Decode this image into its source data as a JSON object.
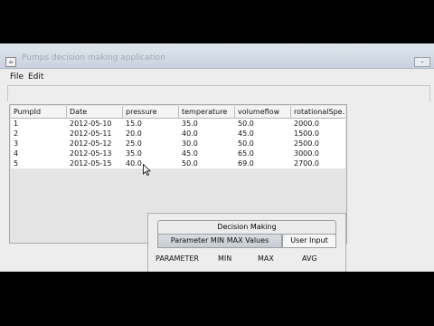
{
  "window": {
    "title": "Pumps decision making application"
  },
  "menu": {
    "items": [
      "File",
      "Edit"
    ]
  },
  "table": {
    "columns": [
      "PumpId",
      "Date",
      "pressure",
      "temperature",
      "volumeflow",
      "rotationalSpe..."
    ],
    "rows": [
      [
        "1",
        "2012-05-10",
        "15.0",
        "35.0",
        "50.0",
        "2000.0"
      ],
      [
        "2",
        "2012-05-11",
        "20.0",
        "40.0",
        "45.0",
        "1500.0"
      ],
      [
        "3",
        "2012-05-12",
        "25.0",
        "30.0",
        "50.0",
        "2500.0"
      ],
      [
        "4",
        "2012-05-13",
        "35.0",
        "45.0",
        "65.0",
        "3000.0"
      ],
      [
        "5",
        "2012-05-15",
        "40.0",
        "50.0",
        "69.0",
        "2700.0"
      ]
    ]
  },
  "tabs": {
    "top": "Decision Making",
    "selected": "Parameter MIN MAX Values",
    "other": "User Input"
  },
  "stats_header": {
    "parameter": "PARAMETER",
    "min": "MIN",
    "max": "MAX",
    "avg": "AVG"
  }
}
